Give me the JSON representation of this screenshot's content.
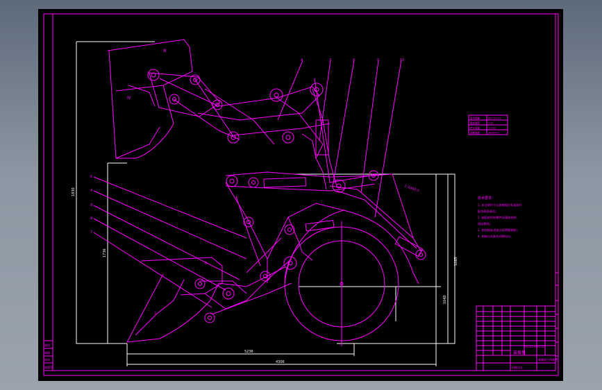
{
  "drawing": {
    "part_labels": {
      "boom_bucket": "Ⅲ",
      "front_gate": "Ⅱ",
      "lower_bucket": "Ⅰ",
      "tilt_bucket": "Ⅳ"
    },
    "callouts_top": [
      "4",
      "3",
      "8",
      "5",
      "10"
    ],
    "callouts_left": [
      "6",
      "4",
      "8",
      "9",
      "7"
    ],
    "dim_overall_height": "1830",
    "dim_mid_height": "1736",
    "dim_wheel": "1040",
    "dim_bottom_short": "5236",
    "dim_bottom_long": "4306",
    "dim_right_small": "1085",
    "slope_label": "1:5000.0",
    "small_table": {
      "rows": [
        [
          "型号规格",
          "BZ-250-01"
        ],
        [
          "额定载荷",
          "2.5t"
        ],
        [
          "铲斗容量",
          "1.2m3"
        ],
        [
          "卸载高度",
          "2800mm"
        ]
      ]
    },
    "technical_requirements": {
      "title": "技术要求：",
      "lines": [
        "1. 未注明尺寸公差按相应标准执行",
        "   配合表面清洁；",
        "2. 装配前所有零件须清除毛刺、",
        "   锐边倒钝；",
        "3. 各铰接处须加注润滑脂装配；",
        "4. 销轴与孔配合间隙均匀。"
      ]
    },
    "title_block": {
      "drawing_title": "装载机",
      "drawing_no": "ZXJ-2019-001-00",
      "subtitle": "装载机工作装置",
      "company": "机械设计"
    },
    "left_stamp": [
      "借用",
      "描图",
      "校对",
      "底图号"
    ]
  }
}
